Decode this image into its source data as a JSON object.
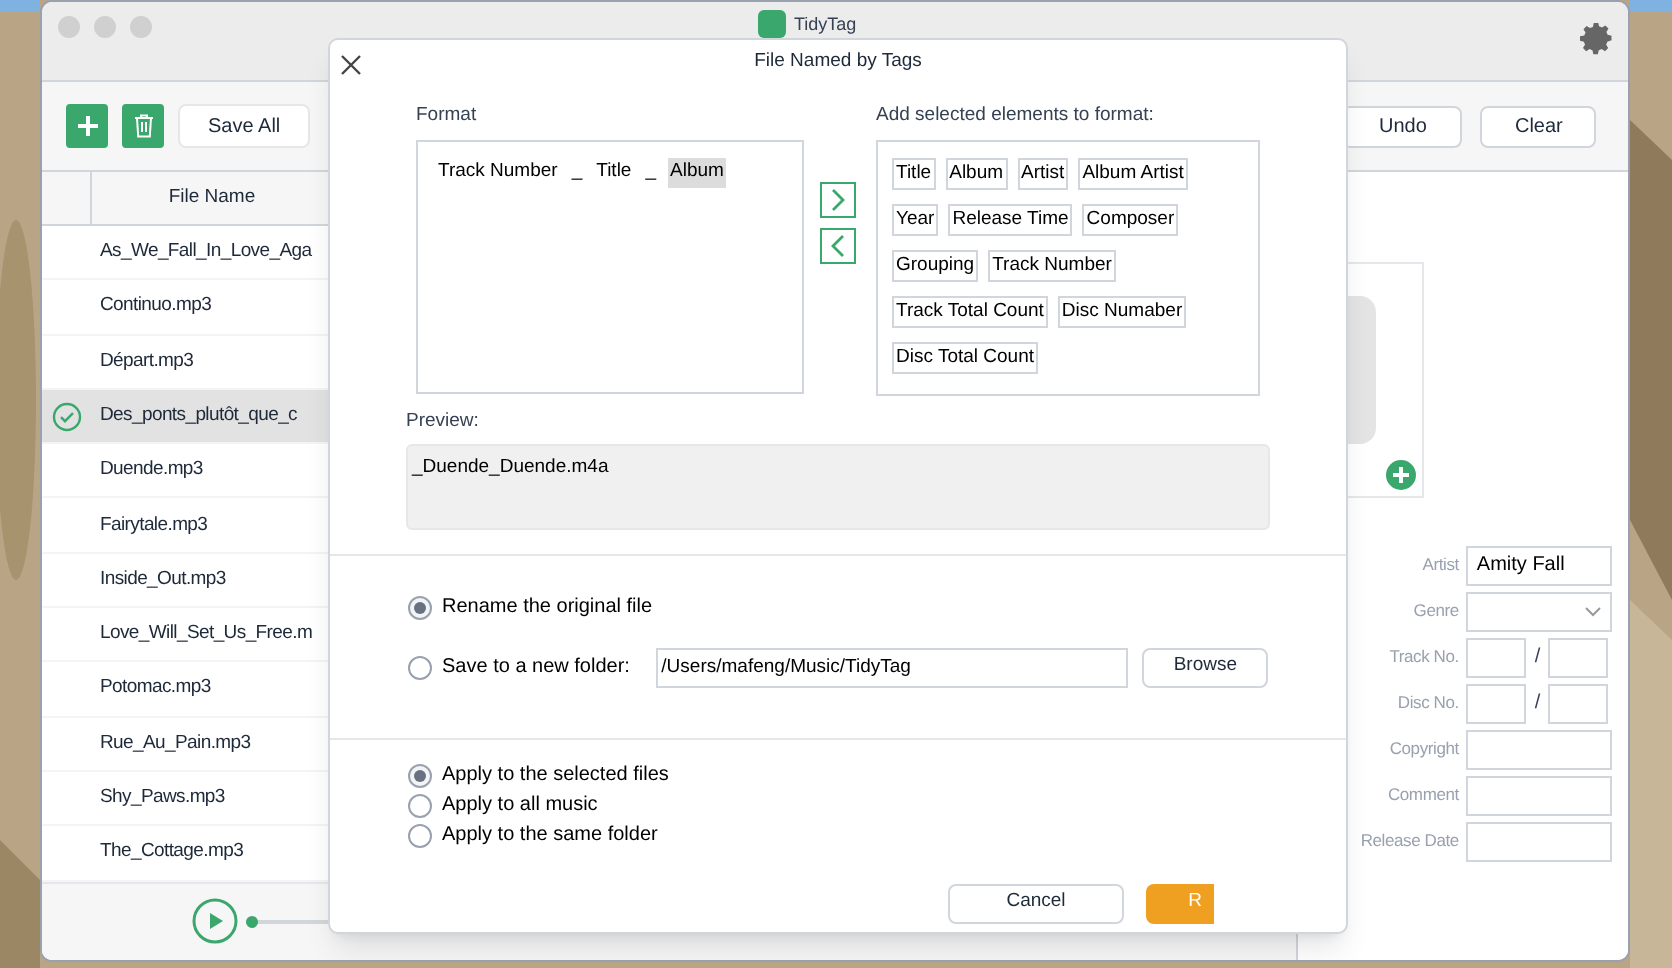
{
  "window": {
    "title": "TidyTag"
  },
  "toolbar": {
    "save_all": "Save All",
    "undo": "Undo",
    "clear": "Clear"
  },
  "file_list": {
    "column": "File Name",
    "rows": [
      {
        "name": "As_We_Fall_In_Love_Aga",
        "selected": false
      },
      {
        "name": "Continuo.mp3",
        "selected": false
      },
      {
        "name": "Départ.mp3",
        "selected": false
      },
      {
        "name": "Des_ponts_plutôt_que_c",
        "selected": true
      },
      {
        "name": "Duende.mp3",
        "selected": false
      },
      {
        "name": "Fairytale.mp3",
        "selected": false
      },
      {
        "name": "Inside_Out.mp3",
        "selected": false
      },
      {
        "name": "Love_Will_Set_Us_Free.m",
        "selected": false
      },
      {
        "name": "Potomac.mp3",
        "selected": false
      },
      {
        "name": "Rue_Au_Pain.mp3",
        "selected": false
      },
      {
        "name": "Shy_Paws.mp3",
        "selected": false
      },
      {
        "name": "The_Cottage.mp3",
        "selected": false
      }
    ]
  },
  "player": {
    "level": 0
  },
  "tag_editor": {
    "fields": [
      {
        "label": "Artist",
        "kind": "text",
        "value": "Amity Fall"
      },
      {
        "label": "Genre",
        "kind": "select"
      },
      {
        "label": "Track No.",
        "kind": "pair",
        "separator": "/"
      },
      {
        "label": "Disc No.",
        "kind": "pair",
        "separator": "/"
      },
      {
        "label": "Copyright",
        "kind": "text"
      },
      {
        "label": "Comment",
        "kind": "text"
      },
      {
        "label": "Release Date",
        "kind": "text"
      }
    ]
  },
  "dialog": {
    "title": "File Named by Tags",
    "format": {
      "label": "Format",
      "tokens": [
        {
          "text": "Track Number",
          "selected": false
        },
        {
          "text": "_",
          "selected": false
        },
        {
          "text": "Title",
          "selected": false
        },
        {
          "text": "_",
          "selected": false
        },
        {
          "text": "Album",
          "selected": true
        }
      ]
    },
    "elements": {
      "label": "Add selected elements to format:",
      "items": [
        "Title",
        "Album",
        "Artist",
        "Album Artist",
        "Year",
        "Release Time",
        "Composer",
        "Grouping",
        "Track Number",
        "Track Total Count",
        "Disc Numaber",
        "Disc Total Count"
      ]
    },
    "preview": {
      "label": "Preview:",
      "value": "_Duende_Duende.m4a"
    },
    "save_options": [
      {
        "label": "Rename the original file",
        "selected": true
      },
      {
        "label": "Save to a new folder:",
        "selected": false
      }
    ],
    "folder_path": "/Users/mafeng/Music/TidyTag",
    "browse": "Browse",
    "scope_options": [
      {
        "label": "Apply to the selected files",
        "selected": true
      },
      {
        "label": "Apply to all music",
        "selected": false
      },
      {
        "label": "Apply to the same folder",
        "selected": false
      }
    ],
    "cancel": "Cancel",
    "confirm": "R"
  }
}
